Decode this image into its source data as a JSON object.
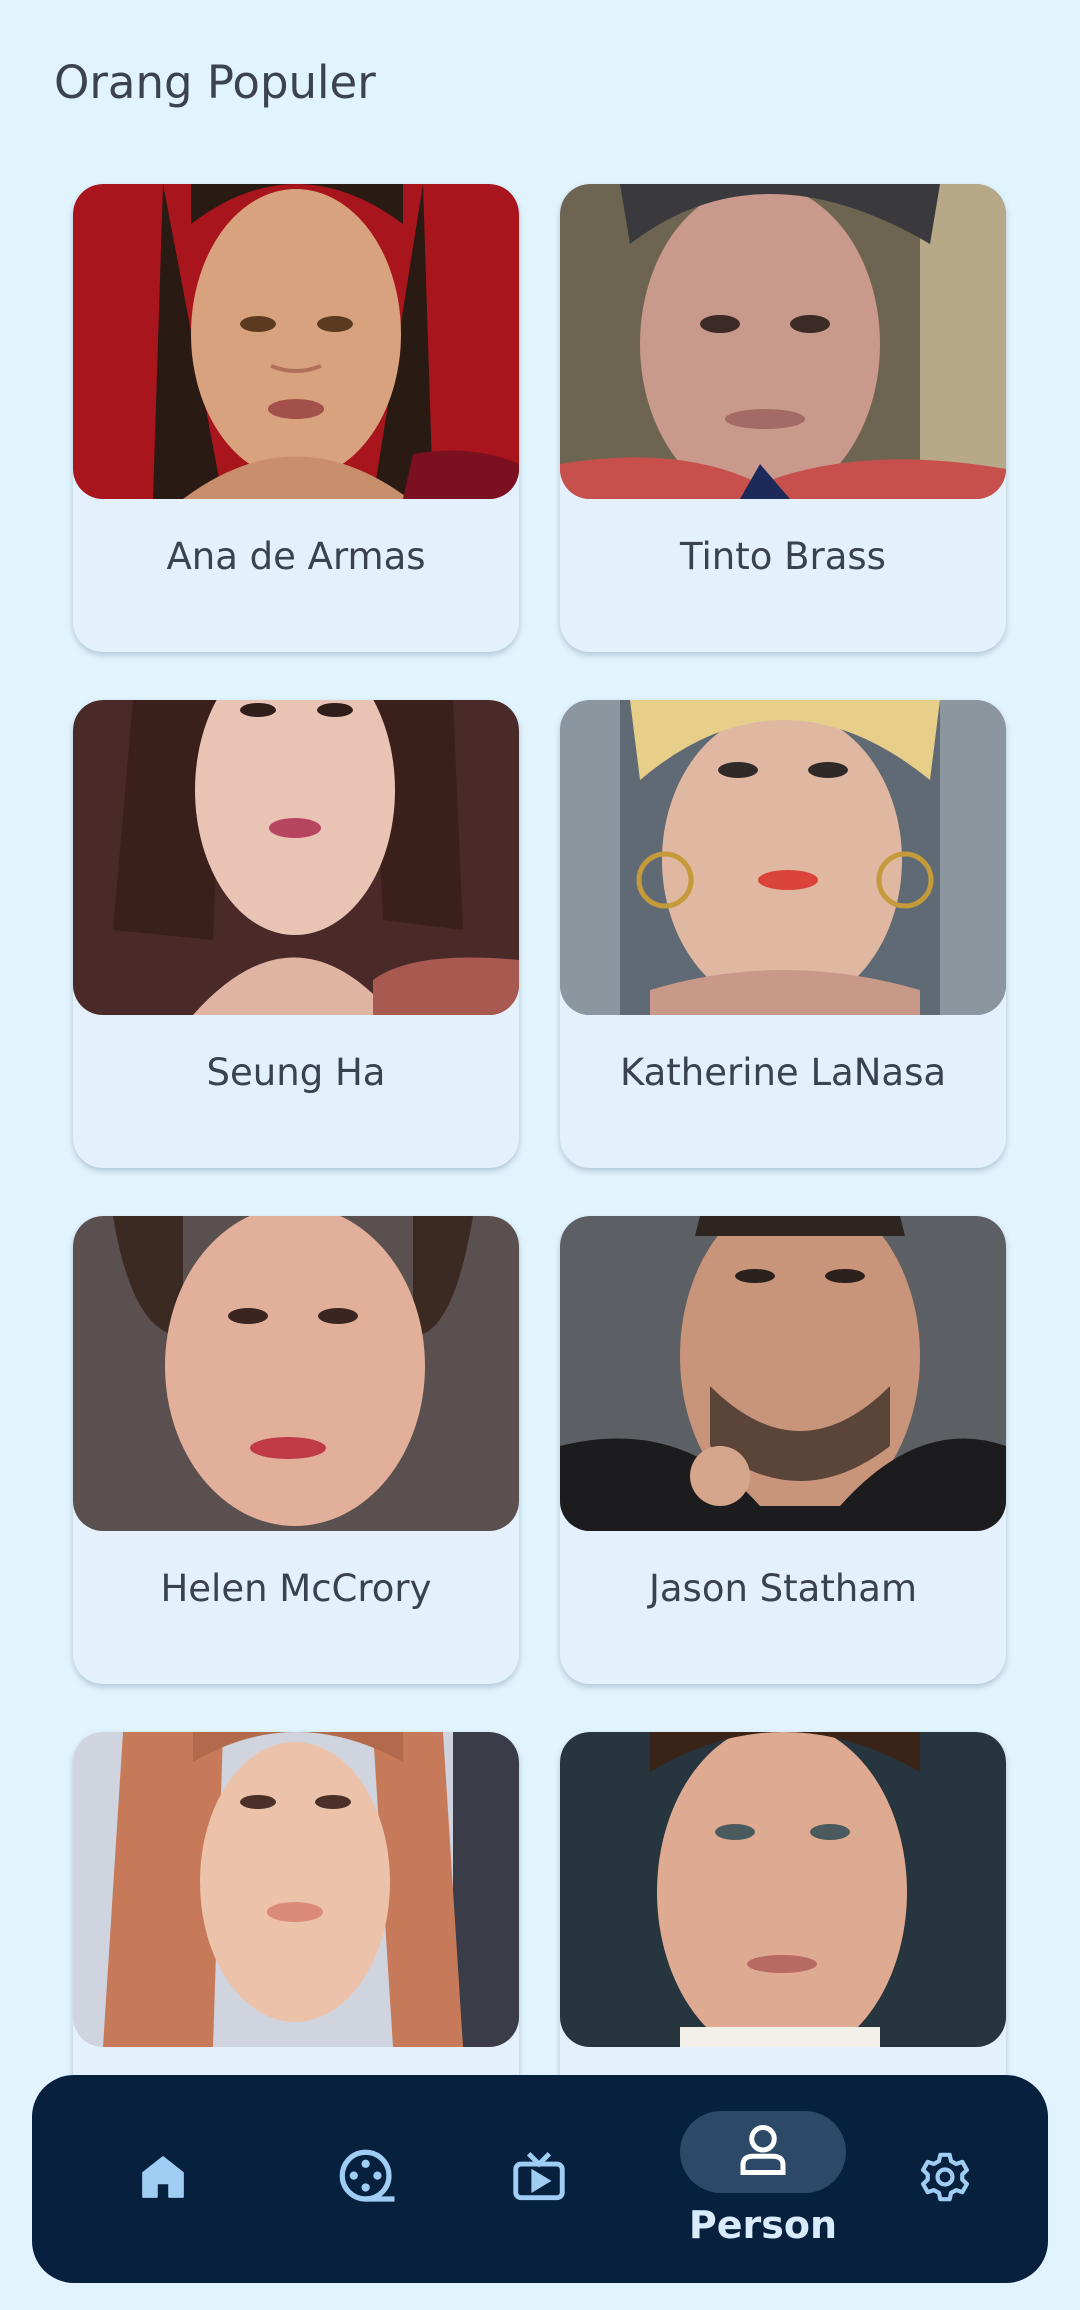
{
  "page": {
    "title": "Orang Populer"
  },
  "people": [
    {
      "name": "Ana de Armas"
    },
    {
      "name": "Tinto Brass"
    },
    {
      "name": "Seung Ha"
    },
    {
      "name": "Katherine LaNasa"
    },
    {
      "name": "Helen McCrory"
    },
    {
      "name": "Jason Statham"
    },
    {
      "name": ""
    },
    {
      "name": ""
    }
  ],
  "nav": {
    "items": [
      {
        "icon": "home-icon",
        "label": ""
      },
      {
        "icon": "film-reel-icon",
        "label": ""
      },
      {
        "icon": "tv-icon",
        "label": ""
      },
      {
        "icon": "person-icon",
        "label": "Person",
        "active": true
      },
      {
        "icon": "gear-icon",
        "label": ""
      }
    ]
  },
  "colors": {
    "background": "#e1f3fd",
    "card": "#e4f1fc",
    "nav_background": "#06203e",
    "nav_active_pill": "#2c4a68",
    "nav_icon": "#9fcdf3"
  }
}
